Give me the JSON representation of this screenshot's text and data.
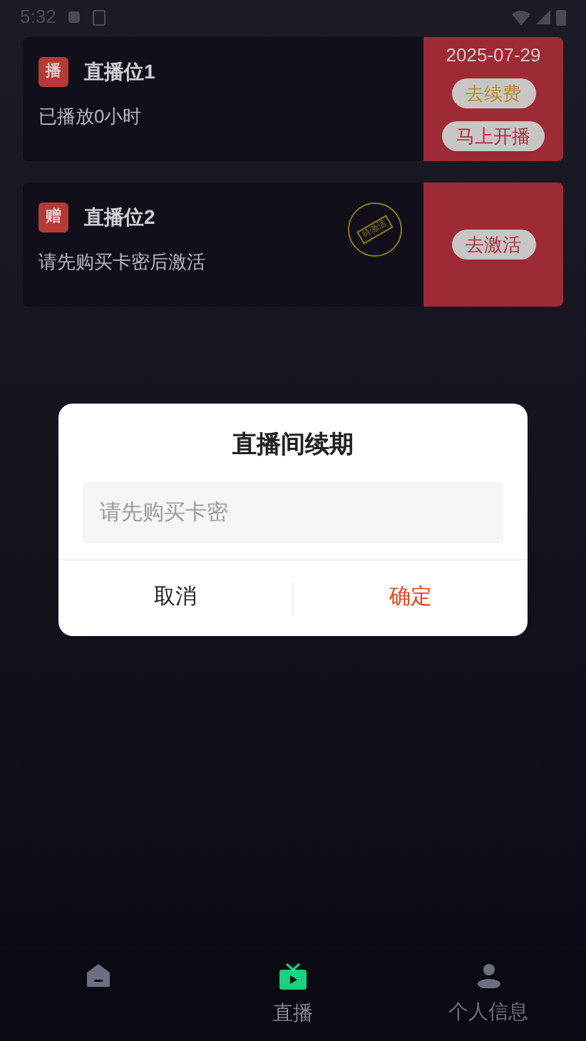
{
  "status_bar": {
    "time": "5:32"
  },
  "slots": [
    {
      "badge": "播",
      "title": "直播位1",
      "subtitle": "已播放0小时",
      "date": "2025-07-29",
      "buttons": [
        {
          "label": "去续费",
          "kind": "renew"
        },
        {
          "label": "马上开播",
          "kind": "start"
        }
      ]
    },
    {
      "badge": "赠",
      "title": "直播位2",
      "subtitle": "请先购买卡密后激活",
      "stamp": "待激活",
      "buttons": [
        {
          "label": "去激活",
          "kind": "activate"
        }
      ]
    }
  ],
  "dialog": {
    "title": "直播间续期",
    "placeholder": "请先购买卡密",
    "buttons": [
      {
        "label": "取消",
        "kind": "cancel"
      },
      {
        "label": "确定",
        "kind": "confirm"
      }
    ]
  },
  "tab_bar": [
    {
      "kind": "home",
      "selected": false
    },
    {
      "kind": "live",
      "label": "直播",
      "selected": true
    },
    {
      "kind": "profile",
      "label": "个人信息",
      "selected": false
    }
  ]
}
